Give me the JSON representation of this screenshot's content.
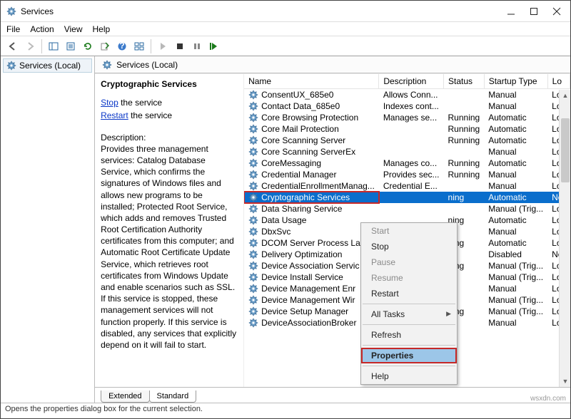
{
  "window": {
    "title": "Services"
  },
  "menu": [
    "File",
    "Action",
    "View",
    "Help"
  ],
  "tree": {
    "root": "Services (Local)"
  },
  "header": {
    "label": "Services (Local)"
  },
  "detail": {
    "title": "Cryptographic Services",
    "stop": "Stop",
    "stop_suffix": " the service",
    "restart": "Restart",
    "restart_suffix": " the service",
    "desc_label": "Description:",
    "desc": "Provides three management services: Catalog Database Service, which confirms the signatures of Windows files and allows new programs to be installed; Protected Root Service, which adds and removes Trusted Root Certification Authority certificates from this computer; and Automatic Root Certificate Update Service, which retrieves root certificates from Windows Update and enable scenarios such as SSL. If this service is stopped, these management services will not function properly. If this service is disabled, any services that explicitly depend on it will fail to start."
  },
  "columns": [
    "Name",
    "Description",
    "Status",
    "Startup Type",
    "Lo"
  ],
  "rows": [
    {
      "name": "ConsentUX_685e0",
      "desc": "Allows Conn...",
      "status": "",
      "stype": "Manual",
      "log": "Loc"
    },
    {
      "name": "Contact Data_685e0",
      "desc": "Indexes cont...",
      "status": "",
      "stype": "Manual",
      "log": "Loc"
    },
    {
      "name": "Core Browsing Protection",
      "desc": "Manages se...",
      "status": "Running",
      "stype": "Automatic",
      "log": "Loc"
    },
    {
      "name": "Core Mail Protection",
      "desc": "",
      "status": "Running",
      "stype": "Automatic",
      "log": "Loc"
    },
    {
      "name": "Core Scanning Server",
      "desc": "",
      "status": "Running",
      "stype": "Automatic",
      "log": "Loc"
    },
    {
      "name": "Core Scanning ServerEx",
      "desc": "",
      "status": "",
      "stype": "Manual",
      "log": "Loc"
    },
    {
      "name": "CoreMessaging",
      "desc": "Manages co...",
      "status": "Running",
      "stype": "Automatic",
      "log": "Loc"
    },
    {
      "name": "Credential Manager",
      "desc": "Provides sec...",
      "status": "Running",
      "stype": "Manual",
      "log": "Loc"
    },
    {
      "name": "CredentialEnrollmentManag...",
      "desc": "Credential E...",
      "status": "",
      "stype": "Manual",
      "log": "Loc"
    },
    {
      "name": "Cryptographic Services",
      "desc": "",
      "status": "ning",
      "stype": "Automatic",
      "log": "Ne",
      "sel": true
    },
    {
      "name": "Data Sharing Service",
      "desc": "",
      "status": "",
      "stype": "Manual (Trig...",
      "log": "Loc"
    },
    {
      "name": "Data Usage",
      "desc": "",
      "status": "ning",
      "stype": "Automatic",
      "log": "Loc"
    },
    {
      "name": "DbxSvc",
      "desc": "",
      "status": "",
      "stype": "Manual",
      "log": "Loc"
    },
    {
      "name": "DCOM Server Process La",
      "desc": "",
      "status": "ning",
      "stype": "Automatic",
      "log": "Loc"
    },
    {
      "name": "Delivery Optimization",
      "desc": "",
      "status": "",
      "stype": "Disabled",
      "log": "Ne"
    },
    {
      "name": "Device Association Servic",
      "desc": "",
      "status": "ning",
      "stype": "Manual (Trig...",
      "log": "Loc"
    },
    {
      "name": "Device Install Service",
      "desc": "",
      "status": "",
      "stype": "Manual (Trig...",
      "log": "Loc"
    },
    {
      "name": "Device Management Enr",
      "desc": "",
      "status": "",
      "stype": "Manual",
      "log": "Loc"
    },
    {
      "name": "Device Management Wir",
      "desc": "",
      "status": "",
      "stype": "Manual (Trig...",
      "log": "Loc"
    },
    {
      "name": "Device Setup Manager",
      "desc": "",
      "status": "ning",
      "stype": "Manual (Trig...",
      "log": "Loc"
    },
    {
      "name": "DeviceAssociationBroker",
      "desc": "",
      "status": "",
      "stype": "Manual",
      "log": "Loc"
    }
  ],
  "context": {
    "start": "Start",
    "stop": "Stop",
    "pause": "Pause",
    "resume": "Resume",
    "restart": "Restart",
    "alltasks": "All Tasks",
    "refresh": "Refresh",
    "properties": "Properties",
    "help": "Help"
  },
  "tabs": {
    "extended": "Extended",
    "standard": "Standard"
  },
  "statusbar": "Opens the properties dialog box for the current selection.",
  "watermark": "wsxdn.com"
}
